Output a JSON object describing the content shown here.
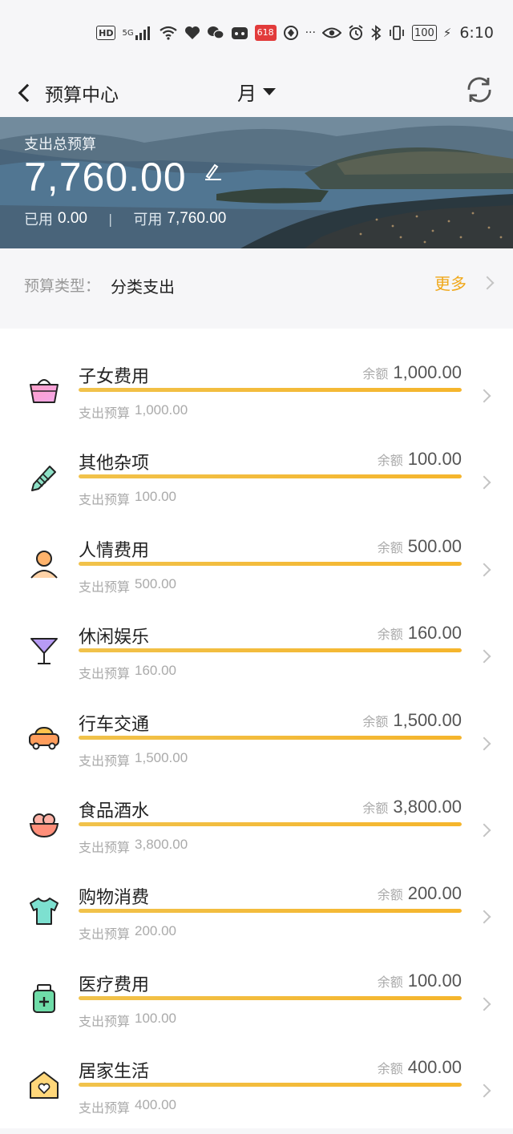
{
  "status_bar": {
    "hd": "HD",
    "network": "5G",
    "promo_badge": "618",
    "battery": "100",
    "time": "6:10"
  },
  "nav": {
    "title": "预算中心",
    "period": "月"
  },
  "banner": {
    "label": "支出总预算",
    "amount": "7,760.00",
    "used_label": "已用",
    "used_value": "0.00",
    "available_label": "可用",
    "available_value": "7,760.00"
  },
  "type_row": {
    "key": "预算类型：",
    "value": "分类支出",
    "more": "更多"
  },
  "labels": {
    "remaining": "余额",
    "budget": "支出预算"
  },
  "colors": {
    "accent": "#f0a81a",
    "bar": "#f5b52c"
  },
  "items": [
    {
      "name": "子女费用",
      "remaining": "1,000.00",
      "budget": "1,000.00",
      "progress": 1.0,
      "icon": "shopping-basket-icon"
    },
    {
      "name": "其他杂项",
      "remaining": "100.00",
      "budget": "100.00",
      "progress": 1.0,
      "icon": "pencil-icon"
    },
    {
      "name": "人情费用",
      "remaining": "500.00",
      "budget": "500.00",
      "progress": 1.0,
      "icon": "person-icon"
    },
    {
      "name": "休闲娱乐",
      "remaining": "160.00",
      "budget": "160.00",
      "progress": 1.0,
      "icon": "cocktail-icon"
    },
    {
      "name": "行车交通",
      "remaining": "1,500.00",
      "budget": "1,500.00",
      "progress": 1.0,
      "icon": "car-icon"
    },
    {
      "name": "食品酒水",
      "remaining": "3,800.00",
      "budget": "3,800.00",
      "progress": 1.0,
      "icon": "food-bowl-icon"
    },
    {
      "name": "购物消费",
      "remaining": "200.00",
      "budget": "200.00",
      "progress": 1.0,
      "icon": "tshirt-icon"
    },
    {
      "name": "医疗费用",
      "remaining": "100.00",
      "budget": "100.00",
      "progress": 1.0,
      "icon": "medicine-bottle-icon"
    },
    {
      "name": "居家生活",
      "remaining": "400.00",
      "budget": "400.00",
      "progress": 1.0,
      "icon": "home-heart-icon"
    }
  ]
}
